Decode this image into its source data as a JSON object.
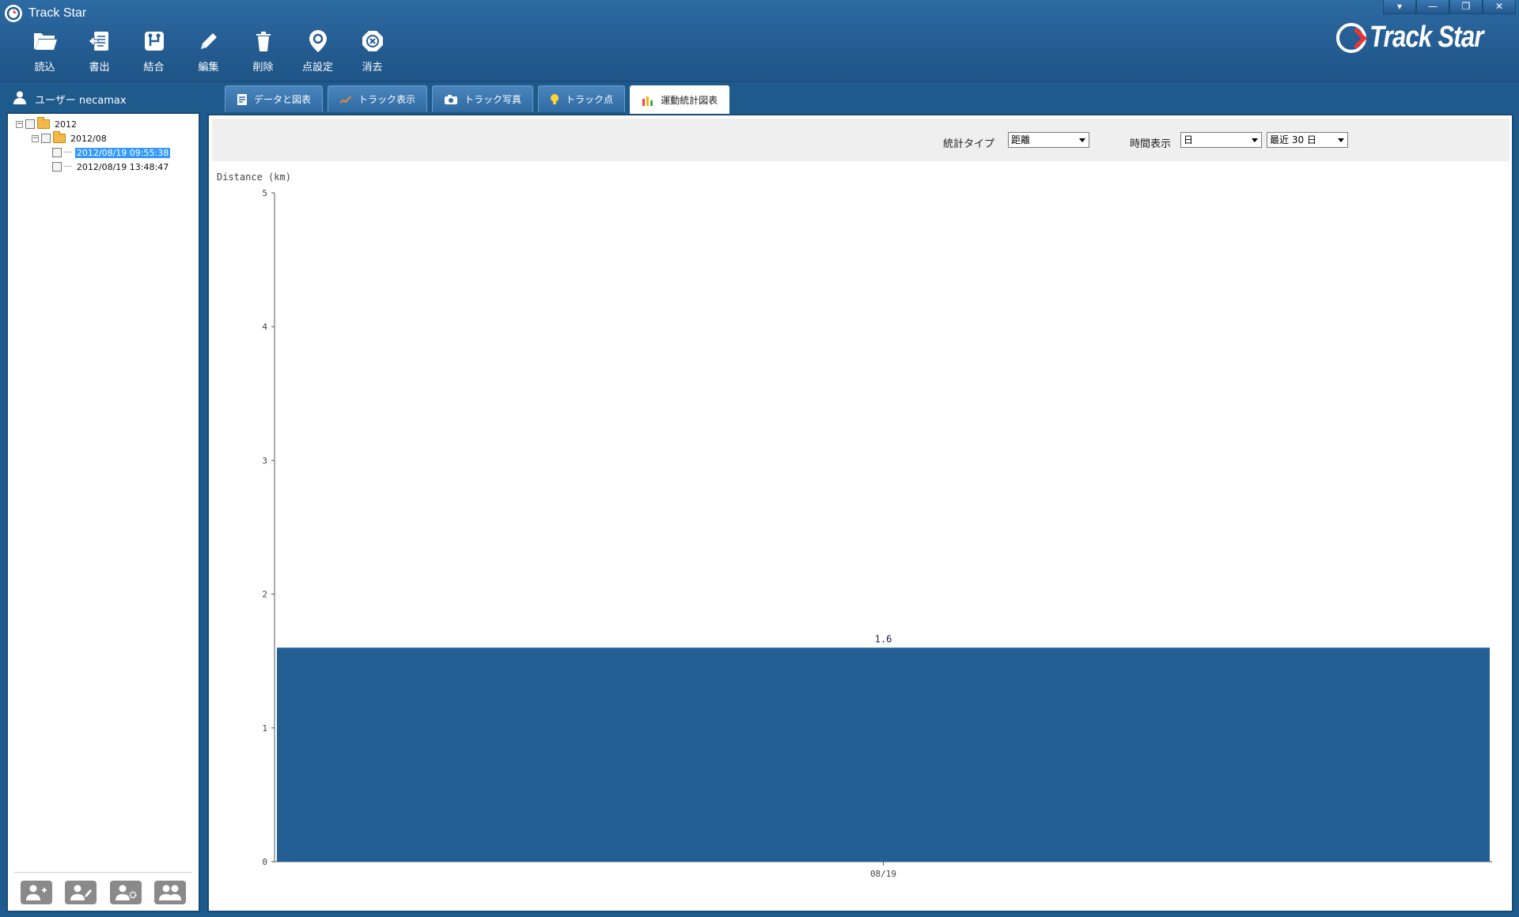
{
  "window": {
    "title": "Track Star",
    "brand_text": "Track Star",
    "controls": [
      "▾",
      "—",
      "❐",
      "✕"
    ]
  },
  "toolbar": {
    "buttons": [
      {
        "label": "読込",
        "icon": "folder-open-icon"
      },
      {
        "label": "書出",
        "icon": "export-icon"
      },
      {
        "label": "結合",
        "icon": "merge-icon"
      },
      {
        "label": "編集",
        "icon": "pencil-icon"
      },
      {
        "label": "削除",
        "icon": "trash-icon"
      },
      {
        "label": "点設定",
        "icon": "map-pin-icon"
      },
      {
        "label": "消去",
        "icon": "clear-icon"
      }
    ]
  },
  "user": {
    "label": "ユーザー necamax",
    "icon": "user-icon"
  },
  "tree": {
    "year": "2012",
    "month": "2012/08",
    "tracks": [
      "2012/08/19 09:55:38",
      "2012/08/19 13:48:47"
    ],
    "selected_track": "2012/08/19 09:55:38"
  },
  "tabs": [
    {
      "label": "データと図表",
      "icon": "table-icon"
    },
    {
      "label": "トラック表示",
      "icon": "track-icon"
    },
    {
      "label": "トラック写真",
      "icon": "camera-icon"
    },
    {
      "label": "トラック点",
      "icon": "bulb-icon"
    },
    {
      "label": "運動統計図表",
      "icon": "bar-chart-icon",
      "active": true
    }
  ],
  "filters": {
    "stat_type_label": "統計タイプ",
    "stat_type_value": "距離",
    "time_label": "時間表示",
    "time_unit_value": "日",
    "range_value": "最近 30 日"
  },
  "footer_buttons": [
    "add-user-icon",
    "edit-user-icon",
    "user-settings-icon",
    "users-icon"
  ],
  "colors": {
    "bar": "#235e94",
    "header": "#245d93",
    "selection": "#3399ff"
  },
  "chart_data": {
    "type": "bar",
    "ylabel": "Distance (km)",
    "xlabel": "",
    "categories": [
      "08/19"
    ],
    "values": [
      1.6
    ],
    "data_labels": [
      "1.6"
    ],
    "ylim": [
      0,
      5
    ],
    "yticks": [
      0,
      1,
      2,
      3,
      4,
      5
    ],
    "grid": false
  }
}
